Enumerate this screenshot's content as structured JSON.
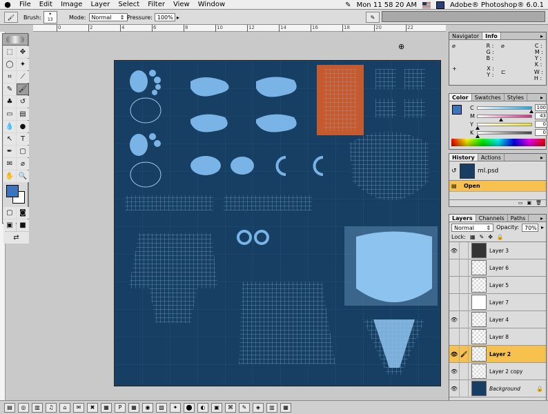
{
  "menubar": {
    "apple_glyph": "●",
    "items": [
      "File",
      "Edit",
      "Image",
      "Layer",
      "Select",
      "Filter",
      "View",
      "Window"
    ],
    "clock": "Mon 11 58 20 AM",
    "app_name": "Adobe® Photoshop® 6.0.1"
  },
  "options": {
    "brush_label": "Brush:",
    "brush_size": "13",
    "mode_label": "Mode:",
    "mode_value": "Normal",
    "pressure_label": "Pressure:",
    "pressure_value": "100%"
  },
  "ruler": {
    "ticks": [
      "0",
      "2",
      "4",
      "6",
      "8",
      "10",
      "12",
      "14",
      "16",
      "18",
      "20",
      "22"
    ]
  },
  "toolbox": {
    "tools": [
      {
        "name": "marquee-tool",
        "glyph": "⬚"
      },
      {
        "name": "move-tool",
        "glyph": "✥"
      },
      {
        "name": "lasso-tool",
        "glyph": "◯"
      },
      {
        "name": "magic-wand-tool",
        "glyph": "✦"
      },
      {
        "name": "crop-tool",
        "glyph": "⌗"
      },
      {
        "name": "slice-tool",
        "glyph": "⟋"
      },
      {
        "name": "healing-tool",
        "glyph": "✎"
      },
      {
        "name": "paintbrush-tool",
        "glyph": "🖌"
      },
      {
        "name": "stamp-tool",
        "glyph": "♣"
      },
      {
        "name": "history-brush-tool",
        "glyph": "↺"
      },
      {
        "name": "eraser-tool",
        "glyph": "▭"
      },
      {
        "name": "gradient-tool",
        "glyph": "▤"
      },
      {
        "name": "blur-tool",
        "glyph": "💧"
      },
      {
        "name": "dodge-tool",
        "glyph": "●"
      },
      {
        "name": "path-select-tool",
        "glyph": "↖"
      },
      {
        "name": "type-tool",
        "glyph": "T"
      },
      {
        "name": "pen-tool",
        "glyph": "✒"
      },
      {
        "name": "shape-tool",
        "glyph": "▢"
      },
      {
        "name": "notes-tool",
        "glyph": "✉"
      },
      {
        "name": "eyedropper-tool",
        "glyph": "⌀"
      },
      {
        "name": "hand-tool",
        "glyph": "✋"
      },
      {
        "name": "zoom-tool",
        "glyph": "🔍"
      }
    ]
  },
  "info_panel": {
    "tab_navigator": "Navigator",
    "tab_info": "Info",
    "rgb": [
      "R :",
      "G :",
      "B :"
    ],
    "cmyk": [
      "C :",
      "M :",
      "Y :",
      "K :"
    ],
    "xy": [
      "X :",
      "Y :"
    ],
    "wh": [
      "W :",
      "H :"
    ]
  },
  "color_panel": {
    "tabs": [
      "Color",
      "Swatches",
      "Styles"
    ],
    "channels": [
      {
        "label": "C",
        "value": "100",
        "pct": 100,
        "color": "#19a9e8"
      },
      {
        "label": "M",
        "value": "43",
        "pct": 43,
        "color": "#d12b8b"
      },
      {
        "label": "Y",
        "value": "0",
        "pct": 0,
        "color": "#e8e21e"
      },
      {
        "label": "K",
        "value": "0",
        "pct": 0,
        "color": "#444444"
      }
    ],
    "percent_sign": "%"
  },
  "history_panel": {
    "tabs": [
      "History",
      "Actions"
    ],
    "snapshot_name": "ml.psd",
    "items": [
      "Open"
    ]
  },
  "layers_panel": {
    "tabs": [
      "Layers",
      "Channels",
      "Paths"
    ],
    "blend_mode": "Normal",
    "opacity_label": "Opacity:",
    "opacity_value": "70%",
    "lock_label": "Lock:",
    "layers": [
      {
        "name": "Layer 3",
        "visible": true,
        "thumb": "dark",
        "active": false
      },
      {
        "name": "Layer 6",
        "visible": false,
        "thumb": "checker",
        "active": false
      },
      {
        "name": "Layer 5",
        "visible": false,
        "thumb": "checker",
        "active": false
      },
      {
        "name": "Layer 7",
        "visible": false,
        "thumb": "white",
        "active": false
      },
      {
        "name": "Layer 4",
        "visible": true,
        "thumb": "checker",
        "active": false
      },
      {
        "name": "Layer 8",
        "visible": false,
        "thumb": "checker",
        "active": false
      },
      {
        "name": "Layer 2",
        "visible": true,
        "thumb": "checker",
        "active": true
      },
      {
        "name": "Layer 2 copy",
        "visible": true,
        "thumb": "checker",
        "active": false
      },
      {
        "name": "Background",
        "visible": true,
        "thumb": "navy",
        "active": false
      }
    ]
  },
  "icons": {
    "eye": "👁",
    "brush": "🖌",
    "lock": "🔒"
  }
}
